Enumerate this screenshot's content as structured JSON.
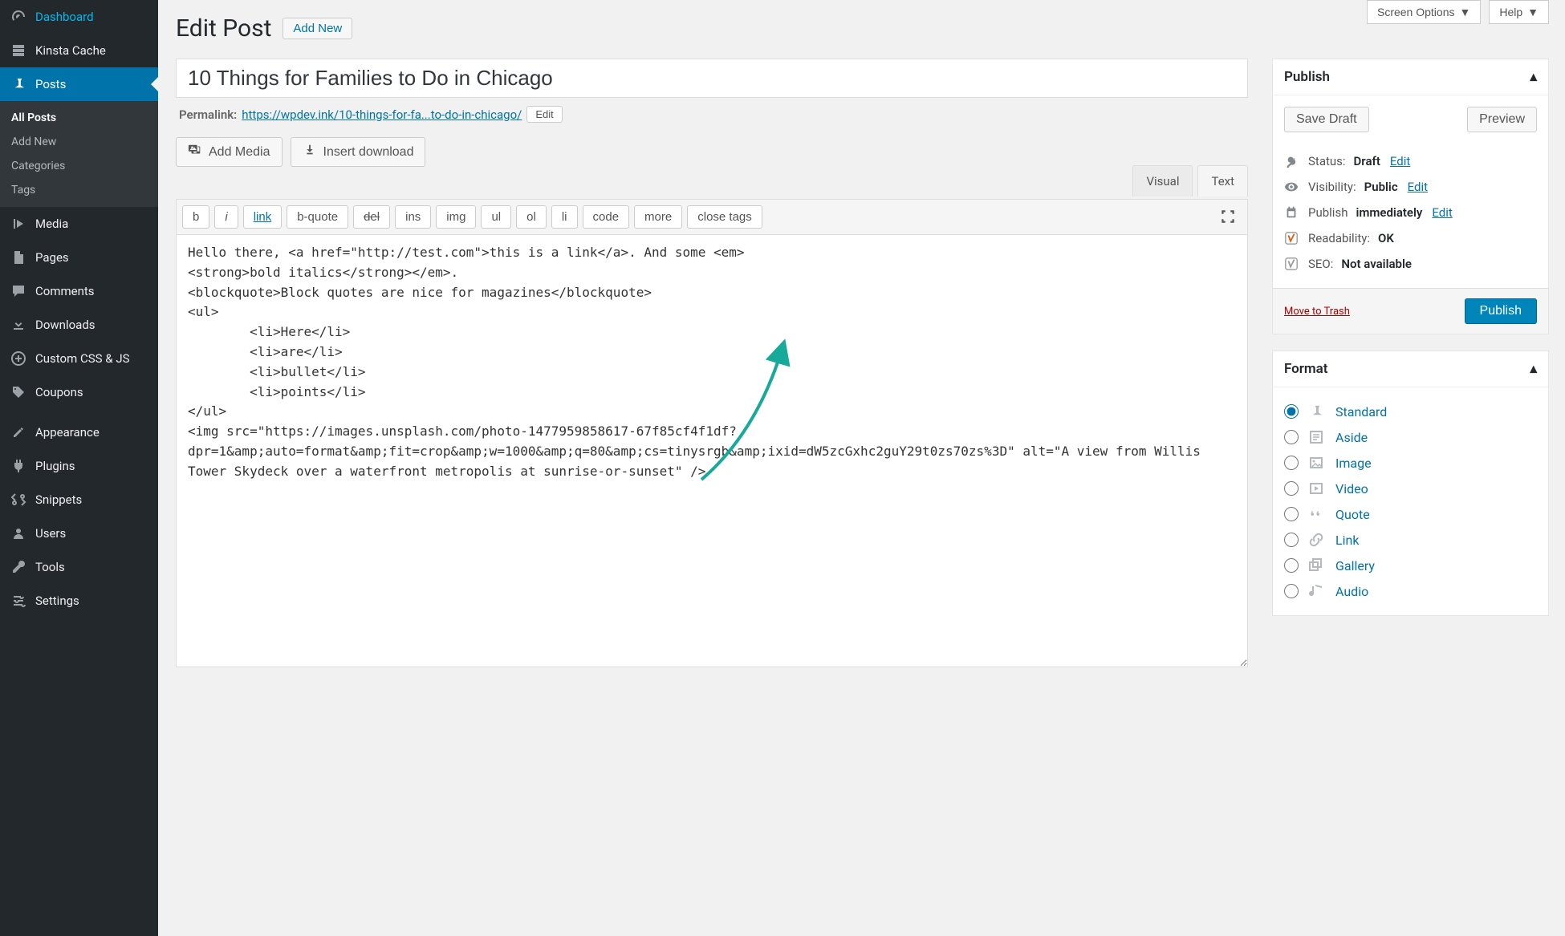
{
  "topbar": {
    "screen_options": "Screen Options",
    "help": "Help"
  },
  "heading": {
    "title": "Edit Post",
    "add_new": "Add New"
  },
  "sidebar": {
    "items": [
      {
        "label": "Dashboard",
        "icon": "dashboard"
      },
      {
        "label": "Kinsta Cache",
        "icon": "cache"
      },
      {
        "label": "Posts",
        "icon": "pin",
        "active": true,
        "submenu": [
          {
            "label": "All Posts",
            "active": true
          },
          {
            "label": "Add New"
          },
          {
            "label": "Categories"
          },
          {
            "label": "Tags"
          }
        ]
      },
      {
        "label": "Media",
        "icon": "media"
      },
      {
        "label": "Pages",
        "icon": "pages"
      },
      {
        "label": "Comments",
        "icon": "comments"
      },
      {
        "label": "Downloads",
        "icon": "downloads"
      },
      {
        "label": "Custom CSS & JS",
        "icon": "plus"
      },
      {
        "label": "Coupons",
        "icon": "tag"
      },
      {
        "label": "Appearance",
        "icon": "appearance"
      },
      {
        "label": "Plugins",
        "icon": "plugins"
      },
      {
        "label": "Snippets",
        "icon": "snippets"
      },
      {
        "label": "Users",
        "icon": "users"
      },
      {
        "label": "Tools",
        "icon": "tools"
      },
      {
        "label": "Settings",
        "icon": "settings"
      }
    ]
  },
  "post": {
    "title": "10 Things for Families to Do in Chicago",
    "permalink_label": "Permalink:",
    "permalink_base": "https://wpdev.ink/",
    "permalink_slug": "10-things-for-fa...to-do-in-chicago/",
    "edit_label": "Edit"
  },
  "editor": {
    "add_media": "Add Media",
    "insert_download": "Insert download",
    "tabs": {
      "visual": "Visual",
      "text": "Text"
    },
    "toolbar": [
      "b",
      "i",
      "link",
      "b-quote",
      "del",
      "ins",
      "img",
      "ul",
      "ol",
      "li",
      "code",
      "more",
      "close tags"
    ],
    "content": "Hello there, <a href=\"http://test.com\">this is a link</a>. And some <em>\n<strong>bold italics</strong></em>.\n<blockquote>Block quotes are nice for magazines</blockquote>\n<ul>\n \t<li>Here</li>\n \t<li>are</li>\n \t<li>bullet</li>\n \t<li>points</li>\n</ul>\n<img src=\"https://images.unsplash.com/photo-1477959858617-67f85cf4f1df?dpr=1&amp;auto=format&amp;fit=crop&amp;w=1000&amp;q=80&amp;cs=tinysrgb&amp;ixid=dW5zcGxhc2guY29t0zs70zs%3D\" alt=\"A view from Willis Tower Skydeck over a waterfront metropolis at sunrise-or-sunset\" />"
  },
  "publish": {
    "title": "Publish",
    "save_draft": "Save Draft",
    "preview": "Preview",
    "status_label": "Status:",
    "status_value": "Draft",
    "visibility_label": "Visibility:",
    "visibility_value": "Public",
    "schedule_label": "Publish",
    "schedule_value": "immediately",
    "readability_label": "Readability:",
    "readability_value": "OK",
    "seo_label": "SEO:",
    "seo_value": "Not available",
    "edit": "Edit",
    "trash": "Move to Trash",
    "publish_btn": "Publish"
  },
  "format": {
    "title": "Format",
    "options": [
      {
        "value": "standard",
        "label": "Standard",
        "checked": true
      },
      {
        "value": "aside",
        "label": "Aside"
      },
      {
        "value": "image",
        "label": "Image"
      },
      {
        "value": "video",
        "label": "Video"
      },
      {
        "value": "quote",
        "label": "Quote"
      },
      {
        "value": "link",
        "label": "Link"
      },
      {
        "value": "gallery",
        "label": "Gallery"
      },
      {
        "value": "audio",
        "label": "Audio"
      }
    ]
  }
}
